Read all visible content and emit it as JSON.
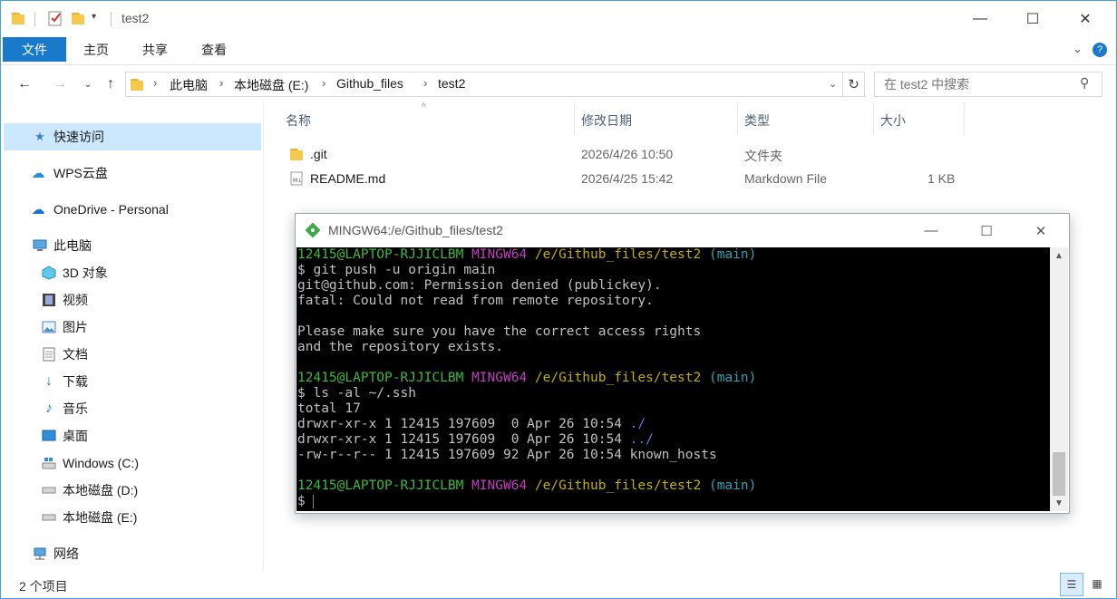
{
  "explorer": {
    "title": "test2",
    "window_controls": {
      "minimize": "—",
      "maximize": "☐",
      "close": "✕"
    },
    "ribbon_tabs": [
      "文件",
      "主页",
      "共享",
      "查看"
    ],
    "breadcrumb": [
      "此电脑",
      "本地磁盘 (E:)",
      "Github_files",
      "test2"
    ],
    "search_placeholder": "在 test2 中搜索",
    "columns": [
      "名称",
      "修改日期",
      "类型",
      "大小"
    ],
    "files": [
      {
        "name": ".git",
        "modified": "2026/4/26 10:50",
        "type": "文件夹",
        "size": "",
        "icon": "folder-icon"
      },
      {
        "name": "README.md",
        "modified": "2026/4/25 15:42",
        "type": "Markdown File",
        "size": "1 KB",
        "icon": "markdown-file-icon"
      }
    ],
    "sidebar": [
      {
        "label": "快速访问",
        "icon": "star-icon",
        "selected": true
      },
      {
        "label": "WPS云盘",
        "icon": "cloud-icon"
      },
      {
        "label": "OneDrive - Personal",
        "icon": "onedrive-icon"
      },
      {
        "label": "此电脑",
        "icon": "computer-icon"
      },
      {
        "label": "3D 对象",
        "icon": "cube-icon"
      },
      {
        "label": "视频",
        "icon": "video-icon"
      },
      {
        "label": "图片",
        "icon": "picture-icon"
      },
      {
        "label": "文档",
        "icon": "document-icon"
      },
      {
        "label": "下载",
        "icon": "download-icon"
      },
      {
        "label": "音乐",
        "icon": "music-icon"
      },
      {
        "label": "桌面",
        "icon": "desktop-icon"
      },
      {
        "label": "Windows (C:)",
        "icon": "windows-drive-icon"
      },
      {
        "label": "本地磁盘 (D:)",
        "icon": "drive-icon"
      },
      {
        "label": "本地磁盘 (E:)",
        "icon": "drive-icon"
      },
      {
        "label": "网络",
        "icon": "network-icon"
      }
    ],
    "status": "2 个项目"
  },
  "terminal": {
    "title": "MINGW64:/e/Github_files/test2",
    "lines": [
      {
        "kind": "prompt",
        "user": "12415@LAPTOP-RJJICLBM",
        "sys": "MINGW64",
        "path": "/e/Github_files/test2",
        "branch": "(main)"
      },
      {
        "kind": "text",
        "text": "$ git push -u origin main"
      },
      {
        "kind": "text",
        "text": "git@github.com: Permission denied (publickey)."
      },
      {
        "kind": "text",
        "text": "fatal: Could not read from remote repository."
      },
      {
        "kind": "text",
        "text": ""
      },
      {
        "kind": "text",
        "text": "Please make sure you have the correct access rights"
      },
      {
        "kind": "text",
        "text": "and the repository exists."
      },
      {
        "kind": "text",
        "text": ""
      },
      {
        "kind": "prompt",
        "user": "12415@LAPTOP-RJJICLBM",
        "sys": "MINGW64",
        "path": "/e/Github_files/test2",
        "branch": "(main)"
      },
      {
        "kind": "text",
        "text": "$ ls -al ~/.ssh"
      },
      {
        "kind": "text",
        "text": "total 17"
      },
      {
        "kind": "ls",
        "text": "drwxr-xr-x 1 12415 197609  0 Apr 26 10:54 ",
        "name": "./"
      },
      {
        "kind": "ls",
        "text": "drwxr-xr-x 1 12415 197609  0 Apr 26 10:54 ",
        "name": "../"
      },
      {
        "kind": "text",
        "text": "-rw-r--r-- 1 12415 197609 92 Apr 26 10:54 known_hosts"
      },
      {
        "kind": "text",
        "text": ""
      },
      {
        "kind": "prompt",
        "user": "12415@LAPTOP-RJJICLBM",
        "sys": "MINGW64",
        "path": "/e/Github_files/test2",
        "branch": "(main)"
      },
      {
        "kind": "text",
        "text": "$ "
      }
    ]
  }
}
